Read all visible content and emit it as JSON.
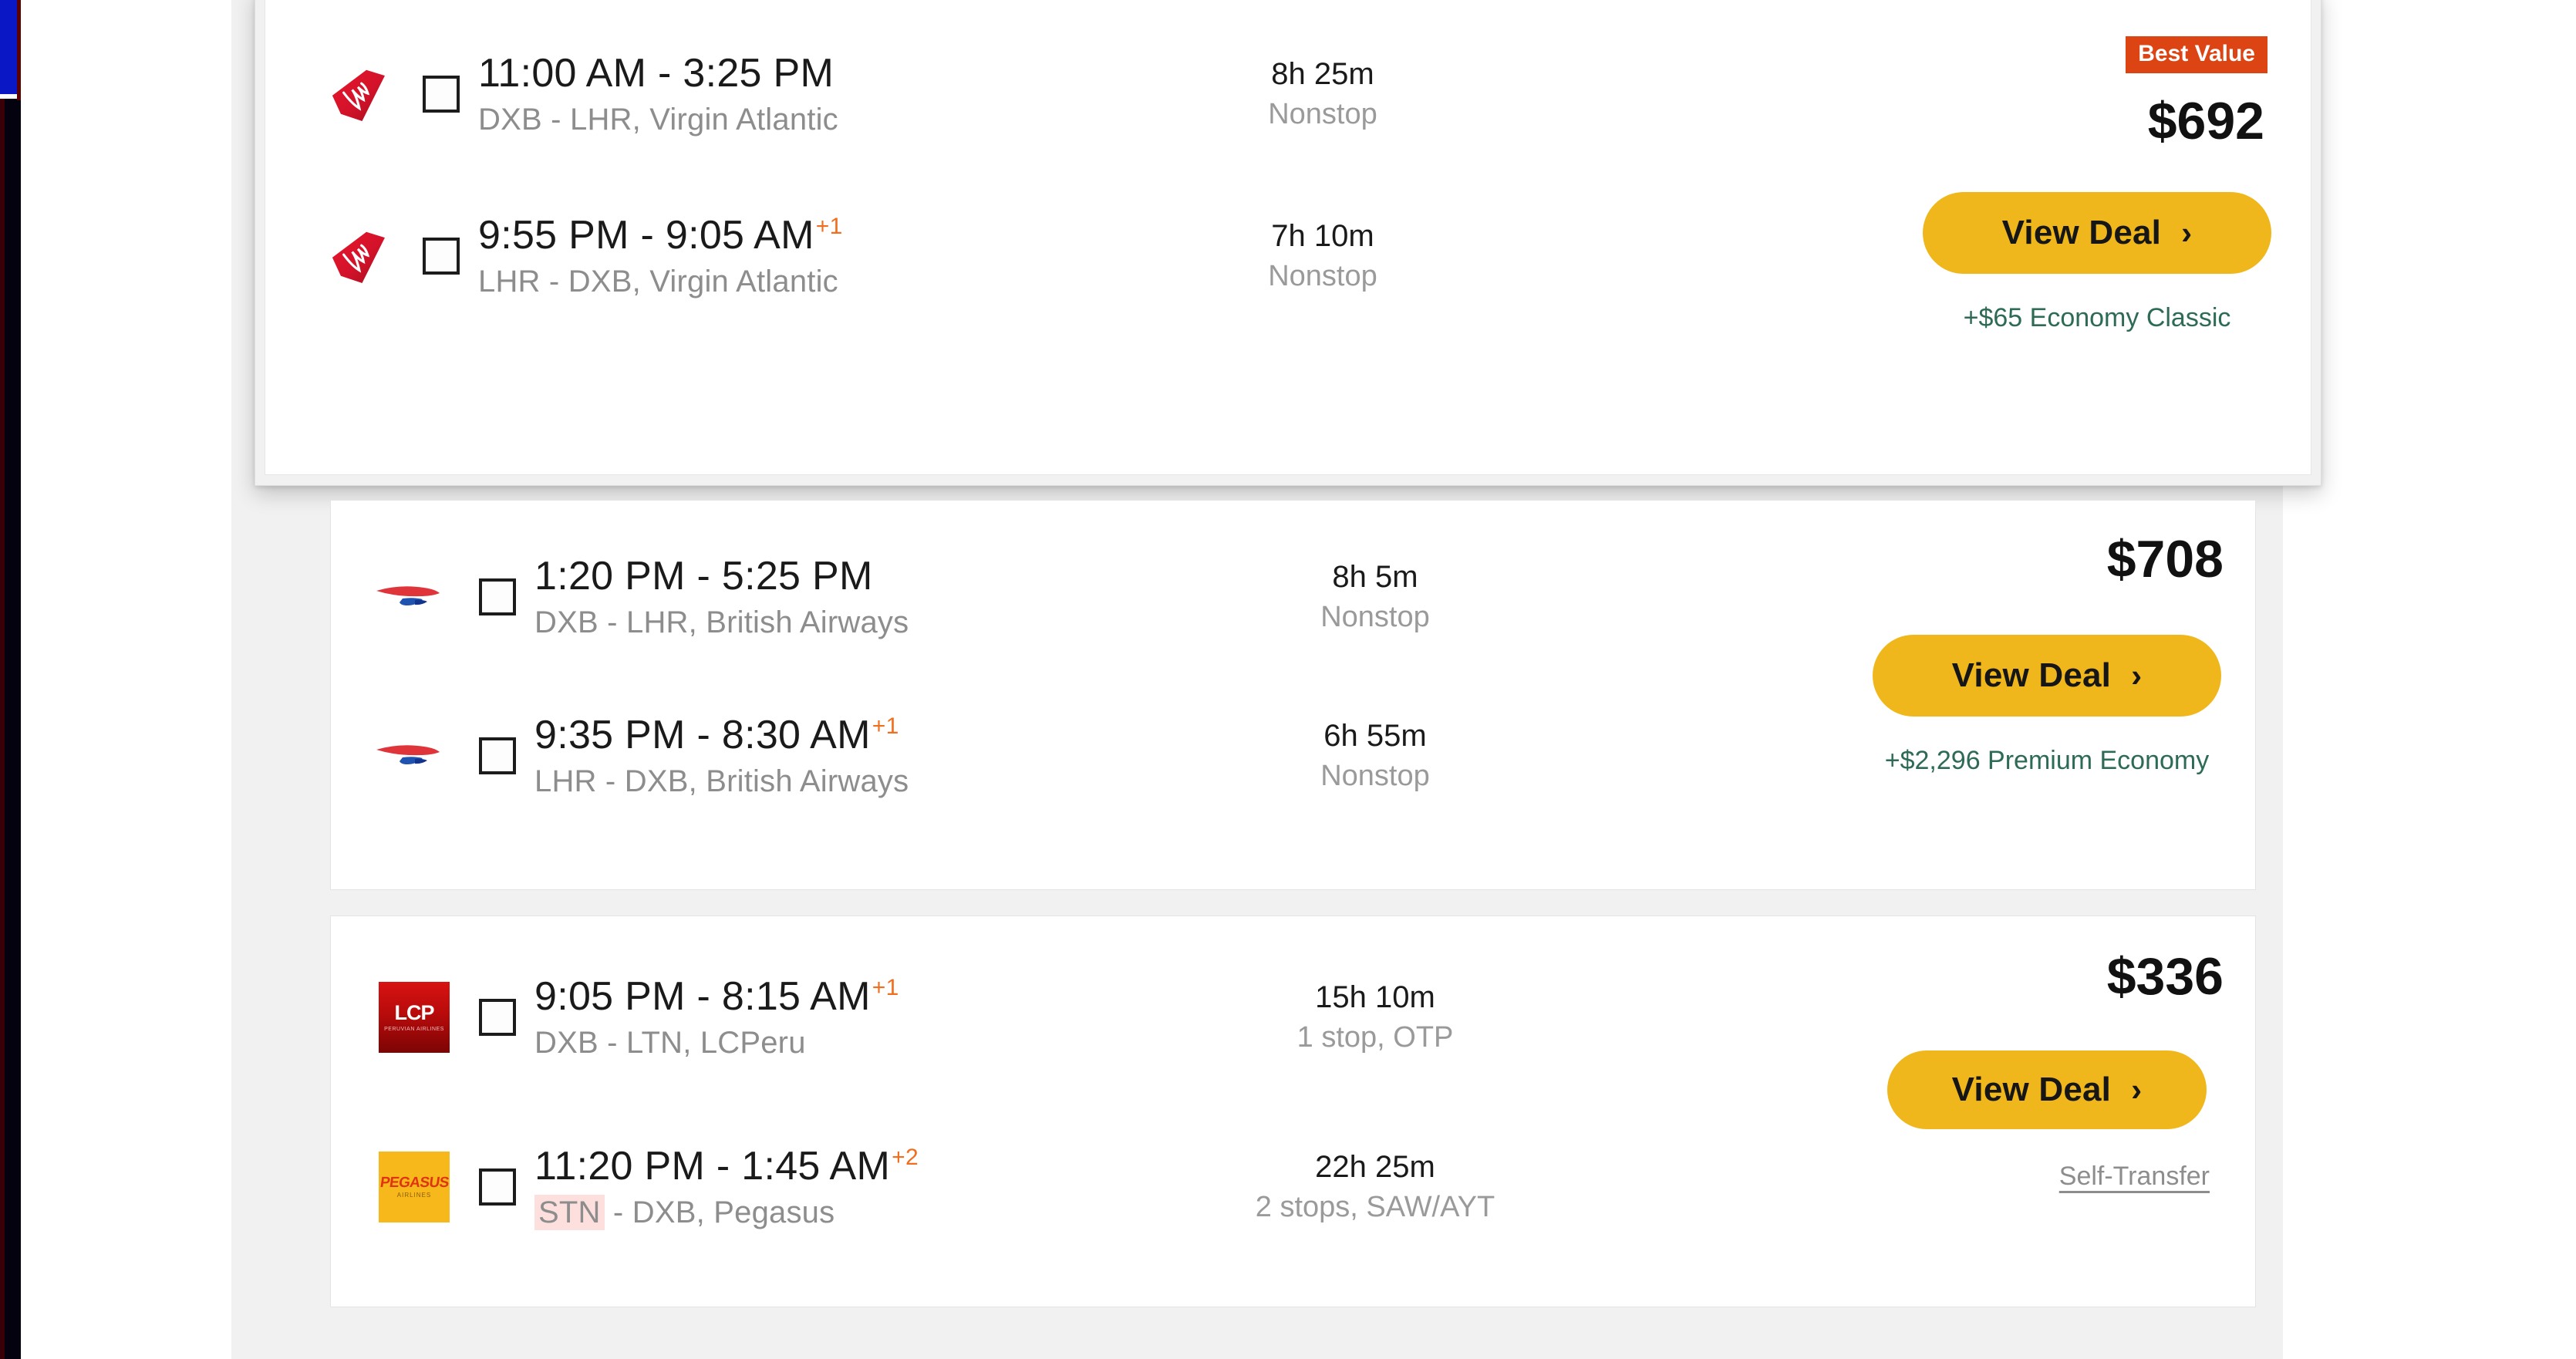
{
  "chrome": {
    "left_strip_blue": "#0a17c4",
    "left_strip_dark": "#05020f"
  },
  "colors": {
    "accent_yellow": "#f0b71c",
    "badge_orange": "#dd4413",
    "plus_day_orange": "#f06e1e",
    "fare_green": "#2d6b55",
    "muted_gray": "#8d8d8d",
    "airport_change_highlight": "#fde0de",
    "page_bg": "#f1f1f1"
  },
  "results": [
    {
      "id": "card-1",
      "highlighted": true,
      "badge": "Best Value",
      "price": "$692",
      "cta": "View Deal",
      "cta_chevron": "›",
      "fare_note": "+$65 Economy Classic",
      "fare_note_type": "upsell",
      "legs": [
        {
          "airline_logo": "virgin-atlantic-logo",
          "checkbox_checked": false,
          "time": "11:00 AM - 3:25 PM",
          "plus_day": "",
          "route": "DXB - LHR, Virgin Atlantic",
          "origin": "DXB",
          "destination": "LHR",
          "airline": "Virgin Atlantic",
          "origin_changed": false,
          "duration": "8h 25m",
          "stops": "Nonstop"
        },
        {
          "airline_logo": "virgin-atlantic-logo",
          "checkbox_checked": false,
          "time": "9:55 PM - 9:05 AM",
          "plus_day": "+1",
          "route": "LHR - DXB, Virgin Atlantic",
          "origin": "LHR",
          "destination": "DXB",
          "airline": "Virgin Atlantic",
          "origin_changed": false,
          "duration": "7h 10m",
          "stops": "Nonstop"
        }
      ]
    },
    {
      "id": "card-2",
      "highlighted": false,
      "badge": "",
      "price": "$708",
      "cta": "View Deal",
      "cta_chevron": "›",
      "fare_note": "+$2,296 Premium Economy",
      "fare_note_type": "upsell",
      "legs": [
        {
          "airline_logo": "british-airways-logo",
          "checkbox_checked": false,
          "time": "1:20 PM - 5:25 PM",
          "plus_day": "",
          "route": "DXB - LHR, British Airways",
          "origin": "DXB",
          "destination": "LHR",
          "airline": "British Airways",
          "origin_changed": false,
          "duration": "8h 5m",
          "stops": "Nonstop"
        },
        {
          "airline_logo": "british-airways-logo",
          "checkbox_checked": false,
          "time": "9:35 PM - 8:30 AM",
          "plus_day": "+1",
          "route": "LHR - DXB, British Airways",
          "origin": "LHR",
          "destination": "DXB",
          "airline": "British Airways",
          "origin_changed": false,
          "duration": "6h 55m",
          "stops": "Nonstop"
        }
      ]
    },
    {
      "id": "card-3",
      "highlighted": false,
      "badge": "",
      "price": "$336",
      "cta": "View Deal",
      "cta_chevron": "›",
      "fare_note": "Self-Transfer",
      "fare_note_type": "self-transfer",
      "legs": [
        {
          "airline_logo": "lcperu-logo",
          "logo_text": "LCP",
          "logo_subtext": "PERUVIAN AIRLINES",
          "checkbox_checked": false,
          "time": "9:05 PM - 8:15 AM",
          "plus_day": "+1",
          "route": "DXB - LTN, LCPeru",
          "origin": "DXB",
          "destination": "LTN",
          "airline": "LCPeru",
          "origin_changed": false,
          "duration": "15h 10m",
          "stops": "1 stop, OTP"
        },
        {
          "airline_logo": "pegasus-logo",
          "logo_text": "PEGASUS",
          "logo_subtext": "AIRLINES",
          "checkbox_checked": false,
          "time": "11:20 PM - 1:45 AM",
          "plus_day": "+2",
          "route": "STN - DXB, Pegasus",
          "origin": "STN",
          "destination": "DXB",
          "airline": "Pegasus",
          "origin_changed": true,
          "duration": "22h 25m",
          "stops": "2 stops, SAW/AYT"
        }
      ]
    }
  ]
}
